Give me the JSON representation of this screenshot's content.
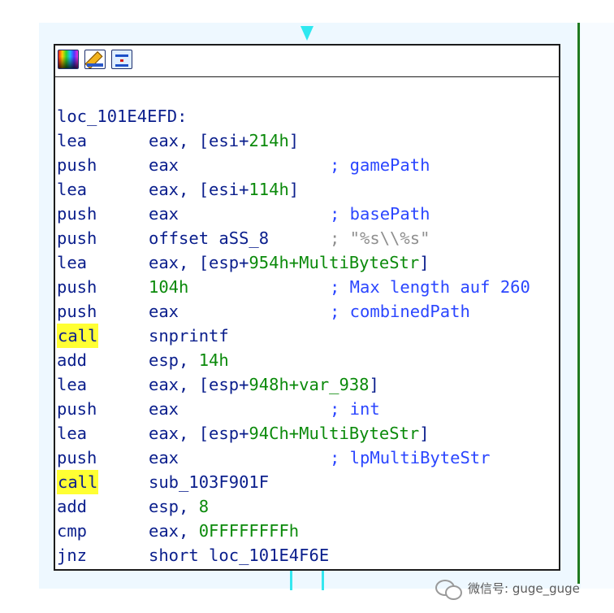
{
  "toolbar": {
    "icons": [
      "color-palette-icon",
      "edit-pencil-icon",
      "graph-overview-icon"
    ]
  },
  "node": {
    "label": "loc_101E4EFD:",
    "instructions": [
      {
        "mnemonic": "lea",
        "operand_text": "eax, [esi+",
        "operand_num": "214h",
        "operand_tail": "]",
        "comment": ""
      },
      {
        "mnemonic": "push",
        "operand_text": "eax",
        "operand_num": "",
        "operand_tail": "",
        "comment": "; gamePath"
      },
      {
        "mnemonic": "lea",
        "operand_text": "eax, [esi+",
        "operand_num": "114h",
        "operand_tail": "]",
        "comment": ""
      },
      {
        "mnemonic": "push",
        "operand_text": "eax",
        "operand_num": "",
        "operand_tail": "",
        "comment": "; basePath"
      },
      {
        "mnemonic": "push",
        "operand_text": "offset aSS_8",
        "operand_num": "",
        "operand_tail": "",
        "comment": "; \"%s\\\\%s\""
      },
      {
        "mnemonic": "lea",
        "operand_text": "eax, [esp+",
        "operand_num": "954h+MultiByteStr",
        "operand_tail": "]",
        "comment": ""
      },
      {
        "mnemonic": "push",
        "operand_text": "",
        "operand_num": "104h",
        "operand_tail": "",
        "comment": "; Max length auf 260"
      },
      {
        "mnemonic": "push",
        "operand_text": "eax",
        "operand_num": "",
        "operand_tail": "",
        "comment": "; combinedPath"
      },
      {
        "mnemonic": "call",
        "operand_text": "snprintf",
        "operand_num": "",
        "operand_tail": "",
        "comment": ""
      },
      {
        "mnemonic": "add",
        "operand_text": "esp, ",
        "operand_num": "14h",
        "operand_tail": "",
        "comment": ""
      },
      {
        "mnemonic": "lea",
        "operand_text": "eax, [esp+",
        "operand_num": "948h+var_938",
        "operand_tail": "]",
        "comment": ""
      },
      {
        "mnemonic": "push",
        "operand_text": "eax",
        "operand_num": "",
        "operand_tail": "",
        "comment": "; int"
      },
      {
        "mnemonic": "lea",
        "operand_text": "eax, [esp+",
        "operand_num": "94Ch+MultiByteStr",
        "operand_tail": "]",
        "comment": ""
      },
      {
        "mnemonic": "push",
        "operand_text": "eax",
        "operand_num": "",
        "operand_tail": "",
        "comment": "; lpMultiByteStr"
      },
      {
        "mnemonic": "call",
        "operand_text": "sub_103F901F",
        "operand_num": "",
        "operand_tail": "",
        "comment": ""
      },
      {
        "mnemonic": "add",
        "operand_text": "esp, ",
        "operand_num": "8",
        "operand_tail": "",
        "comment": ""
      },
      {
        "mnemonic": "cmp",
        "operand_text": "eax, ",
        "operand_num": "0FFFFFFFFh",
        "operand_tail": "",
        "comment": ""
      },
      {
        "mnemonic": "jnz",
        "operand_text": "short loc_101E4F6E",
        "operand_num": "",
        "operand_tail": "",
        "comment": ""
      }
    ]
  },
  "colors": {
    "mnemonic": "#0a1e8c",
    "number": "#0b8a0b",
    "comment": "#2b46ff",
    "string_comment": "#8f8f8f",
    "call_highlight": "#ffff33",
    "edge_cyan": "#2ee8f0",
    "edge_green": "#1f7a1f"
  },
  "watermark": {
    "icon": "wechat-icon",
    "text": "微信号: guge_guge"
  }
}
